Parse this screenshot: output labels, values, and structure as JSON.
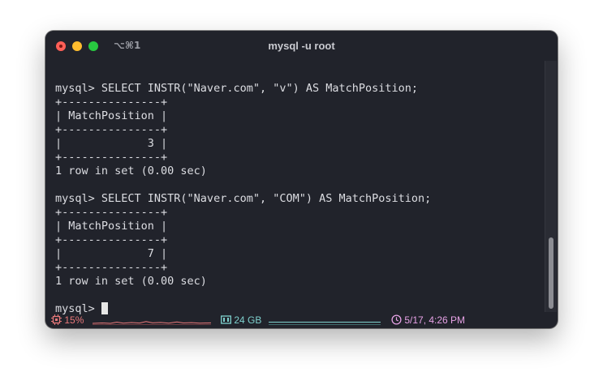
{
  "window": {
    "shortcut": "⌥⌘1",
    "title": "mysql -u root"
  },
  "terminal": {
    "lines": [
      "",
      "mysql> SELECT INSTR(\"Naver.com\", \"v\") AS MatchPosition;",
      "+---------------+",
      "| MatchPosition |",
      "+---------------+",
      "|             3 |",
      "+---------------+",
      "1 row in set (0.00 sec)",
      "",
      "mysql> SELECT INSTR(\"Naver.com\", \"COM\") AS MatchPosition;",
      "+---------------+",
      "| MatchPosition |",
      "+---------------+",
      "|             7 |",
      "+---------------+",
      "1 row in set (0.00 sec)",
      "",
      "mysql> "
    ]
  },
  "status": {
    "cpu": "15%",
    "memory": "24 GB",
    "datetime": "5/17, 4:26 PM",
    "colors": {
      "cpu": "#e8787a",
      "memory": "#7ed0cd",
      "clock": "#e7a2e6"
    },
    "icons": [
      "cpu-chip-icon",
      "memory-module-icon",
      "clock-icon"
    ]
  }
}
